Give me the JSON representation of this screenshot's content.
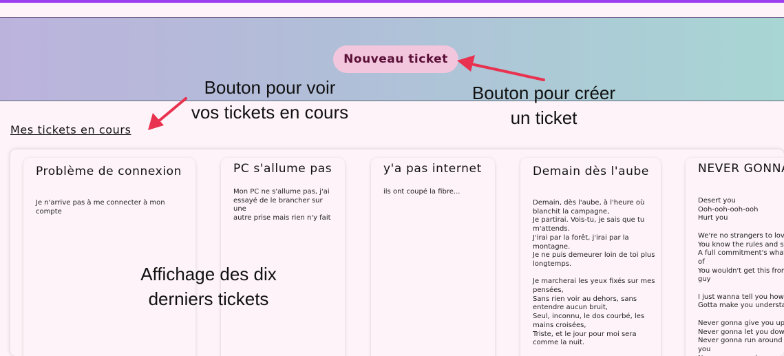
{
  "header": {
    "new_ticket_label": "Nouveau ticket"
  },
  "nav": {
    "my_tickets_label": "Mes tickets en cours"
  },
  "annotations": {
    "view_tickets": "Bouton pour voir\nvos tickets en cours",
    "create_ticket": "Bouton pour créer\nun ticket",
    "display_tickets": "Affichage des dix\nderniers tickets"
  },
  "tickets": [
    {
      "title": "Problème de connexion",
      "body": "Je n'arrive pas à me connecter à mon\ncompte"
    },
    {
      "title": "PC s'allume pas",
      "body": "Mon PC ne s'allume pas, j'ai\nessayé de le brancher sur une\nautre prise mais rien n'y fait"
    },
    {
      "title": "y'a pas internet",
      "body": "ils ont coupé la fibre..."
    },
    {
      "title": "Demain dès l'aube",
      "body": "Demain, dès l'aube, à l'heure où\nblanchit la campagne,\nJe partirai. Vois-tu, je sais que tu\nm'attends.\nJ'irai par la forêt, j'irai par la\nmontagne.\nJe ne puis demeurer loin de toi plus\nlongtemps.\n\nJe marcherai les yeux fixés sur mes\npensées,\nSans rien voir au dehors, sans\nentendre aucun bruit,\nSeul, inconnu, le dos courbé, les\nmains croisées,\nTriste, et le jour pour moi sera\ncomme la nuit."
    },
    {
      "title": "NEVER GONNA GIVE YOU UP",
      "body": "Desert you\nOoh-ooh-ooh-ooh\nHurt you\n\nWe're no strangers to love\nYou know the rules and so do I\nA full commitment's what I'm thinking of\nYou wouldn't get this from any other guy\n\nI just wanna tell you how I'm feeling\nGotta make you understand\n\nNever gonna give you up\nNever gonna let you down\nNever gonna run around and desert you\nNever gonna make you cry\nNever gonna say goodbye"
    }
  ],
  "colors": {
    "accent": "#9b3df0",
    "button_bg": "#f2c6dd",
    "button_text": "#5a0f36",
    "arrow": "#e8324f"
  }
}
